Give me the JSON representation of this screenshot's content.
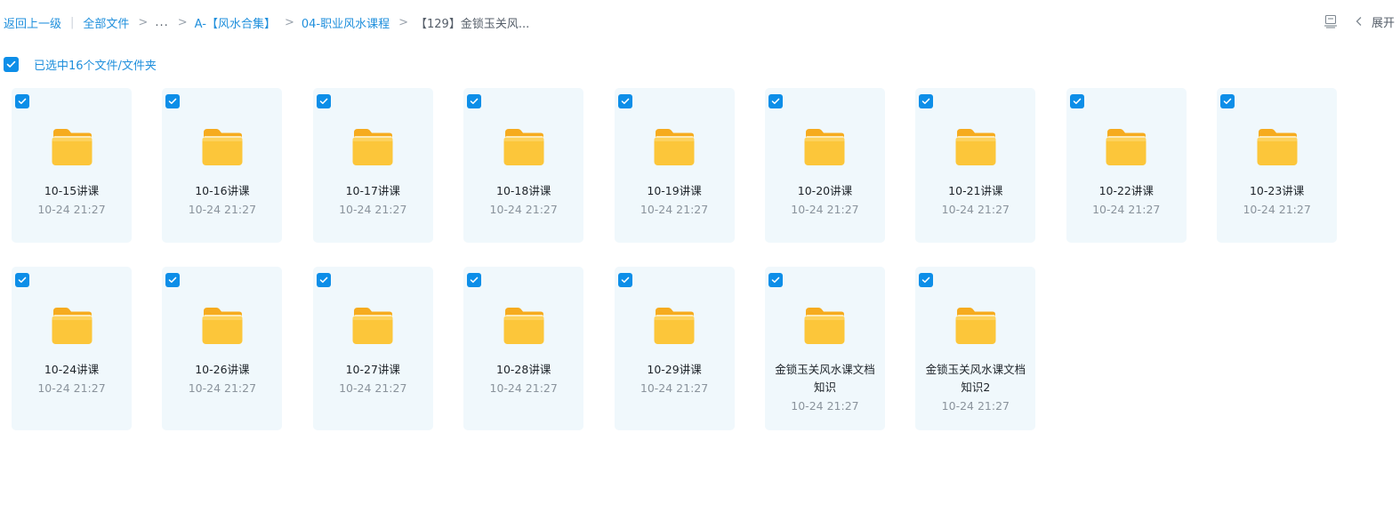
{
  "breadcrumb": {
    "back": "返回上一级",
    "all_files": "全部文件",
    "ellipsis": "...",
    "item_a": "A-【风水合集】",
    "item_04": "04-职业风水课程",
    "current": "【129】金锁玉关风...",
    "sep": ">",
    "bar": "|"
  },
  "top_right": {
    "view_icon": "list-view-icon",
    "chevron_icon": "chevron-left-icon",
    "expand_label": "展开"
  },
  "selection": {
    "count_label": "已选中16个文件/文件夹",
    "checked": true
  },
  "colors": {
    "accent": "#0d8ee8",
    "link": "#1f8fdc",
    "card_bg": "#f0f8fc",
    "folder": "#fcc63a"
  },
  "files": [
    {
      "name": "10-15讲课",
      "time": "10-24 21:27",
      "icon": "folder-icon",
      "checked": true
    },
    {
      "name": "10-16讲课",
      "time": "10-24 21:27",
      "icon": "folder-icon",
      "checked": true
    },
    {
      "name": "10-17讲课",
      "time": "10-24 21:27",
      "icon": "folder-icon",
      "checked": true
    },
    {
      "name": "10-18讲课",
      "time": "10-24 21:27",
      "icon": "folder-icon",
      "checked": true
    },
    {
      "name": "10-19讲课",
      "time": "10-24 21:27",
      "icon": "folder-icon",
      "checked": true
    },
    {
      "name": "10-20讲课",
      "time": "10-24 21:27",
      "icon": "folder-icon",
      "checked": true
    },
    {
      "name": "10-21讲课",
      "time": "10-24 21:27",
      "icon": "folder-icon",
      "checked": true
    },
    {
      "name": "10-22讲课",
      "time": "10-24 21:27",
      "icon": "folder-icon",
      "checked": true
    },
    {
      "name": "10-23讲课",
      "time": "10-24 21:27",
      "icon": "folder-icon",
      "checked": true
    },
    {
      "name": "10-24讲课",
      "time": "10-24 21:27",
      "icon": "folder-icon",
      "checked": true
    },
    {
      "name": "10-26讲课",
      "time": "10-24 21:27",
      "icon": "folder-icon",
      "checked": true
    },
    {
      "name": "10-27讲课",
      "time": "10-24 21:27",
      "icon": "folder-icon",
      "checked": true
    },
    {
      "name": "10-28讲课",
      "time": "10-24 21:27",
      "icon": "folder-icon",
      "checked": true
    },
    {
      "name": "10-29讲课",
      "time": "10-24 21:27",
      "icon": "folder-icon",
      "checked": true
    },
    {
      "name": "金锁玉关风水课文档知识",
      "time": "10-24 21:27",
      "icon": "folder-icon",
      "checked": true
    },
    {
      "name": "金锁玉关风水课文档知识2",
      "time": "10-24 21:27",
      "icon": "folder-icon",
      "checked": true
    }
  ]
}
